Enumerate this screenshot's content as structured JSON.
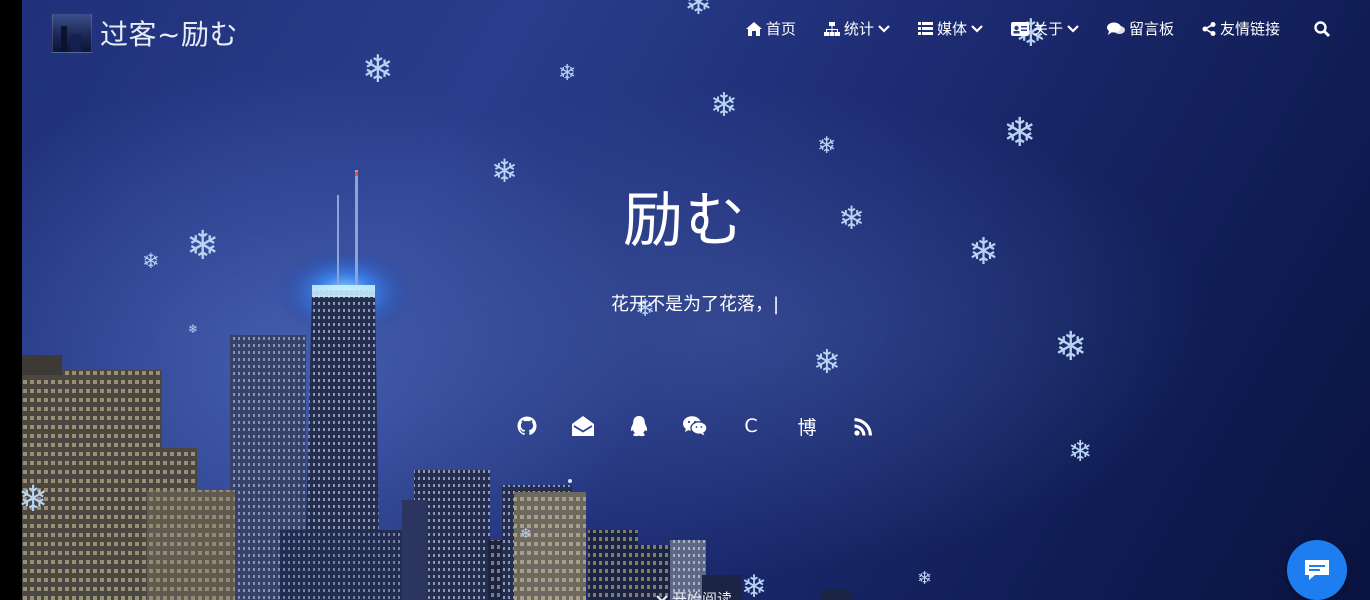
{
  "brand": {
    "title": "过客~励む"
  },
  "nav": {
    "items": [
      {
        "label": "首页",
        "icon": "home-icon",
        "dropdown": false
      },
      {
        "label": "统计",
        "icon": "sitemap-icon",
        "dropdown": true
      },
      {
        "label": "媒体",
        "icon": "list-icon",
        "dropdown": true
      },
      {
        "label": "关于",
        "icon": "id-card-icon",
        "dropdown": true
      },
      {
        "label": "留言板",
        "icon": "comments-icon",
        "dropdown": false
      },
      {
        "label": "友情链接",
        "icon": "share-icon",
        "dropdown": false
      }
    ],
    "search_icon": "search-icon"
  },
  "hero": {
    "title": "励む",
    "subtitle": "花开不是为了花落，|",
    "scroll_hint": "开始阅读"
  },
  "social": [
    {
      "name": "github-icon"
    },
    {
      "name": "email-icon"
    },
    {
      "name": "qq-icon"
    },
    {
      "name": "wechat-icon"
    },
    {
      "name": "csdn-link",
      "text": "C"
    },
    {
      "name": "blog-link",
      "text": "博"
    },
    {
      "name": "rss-icon"
    }
  ],
  "colors": {
    "accent": "#1e7ef0",
    "snowflake": "#b9d3f2",
    "sky_dark": "#0a1440",
    "sky_light": "#2a3d8c"
  }
}
